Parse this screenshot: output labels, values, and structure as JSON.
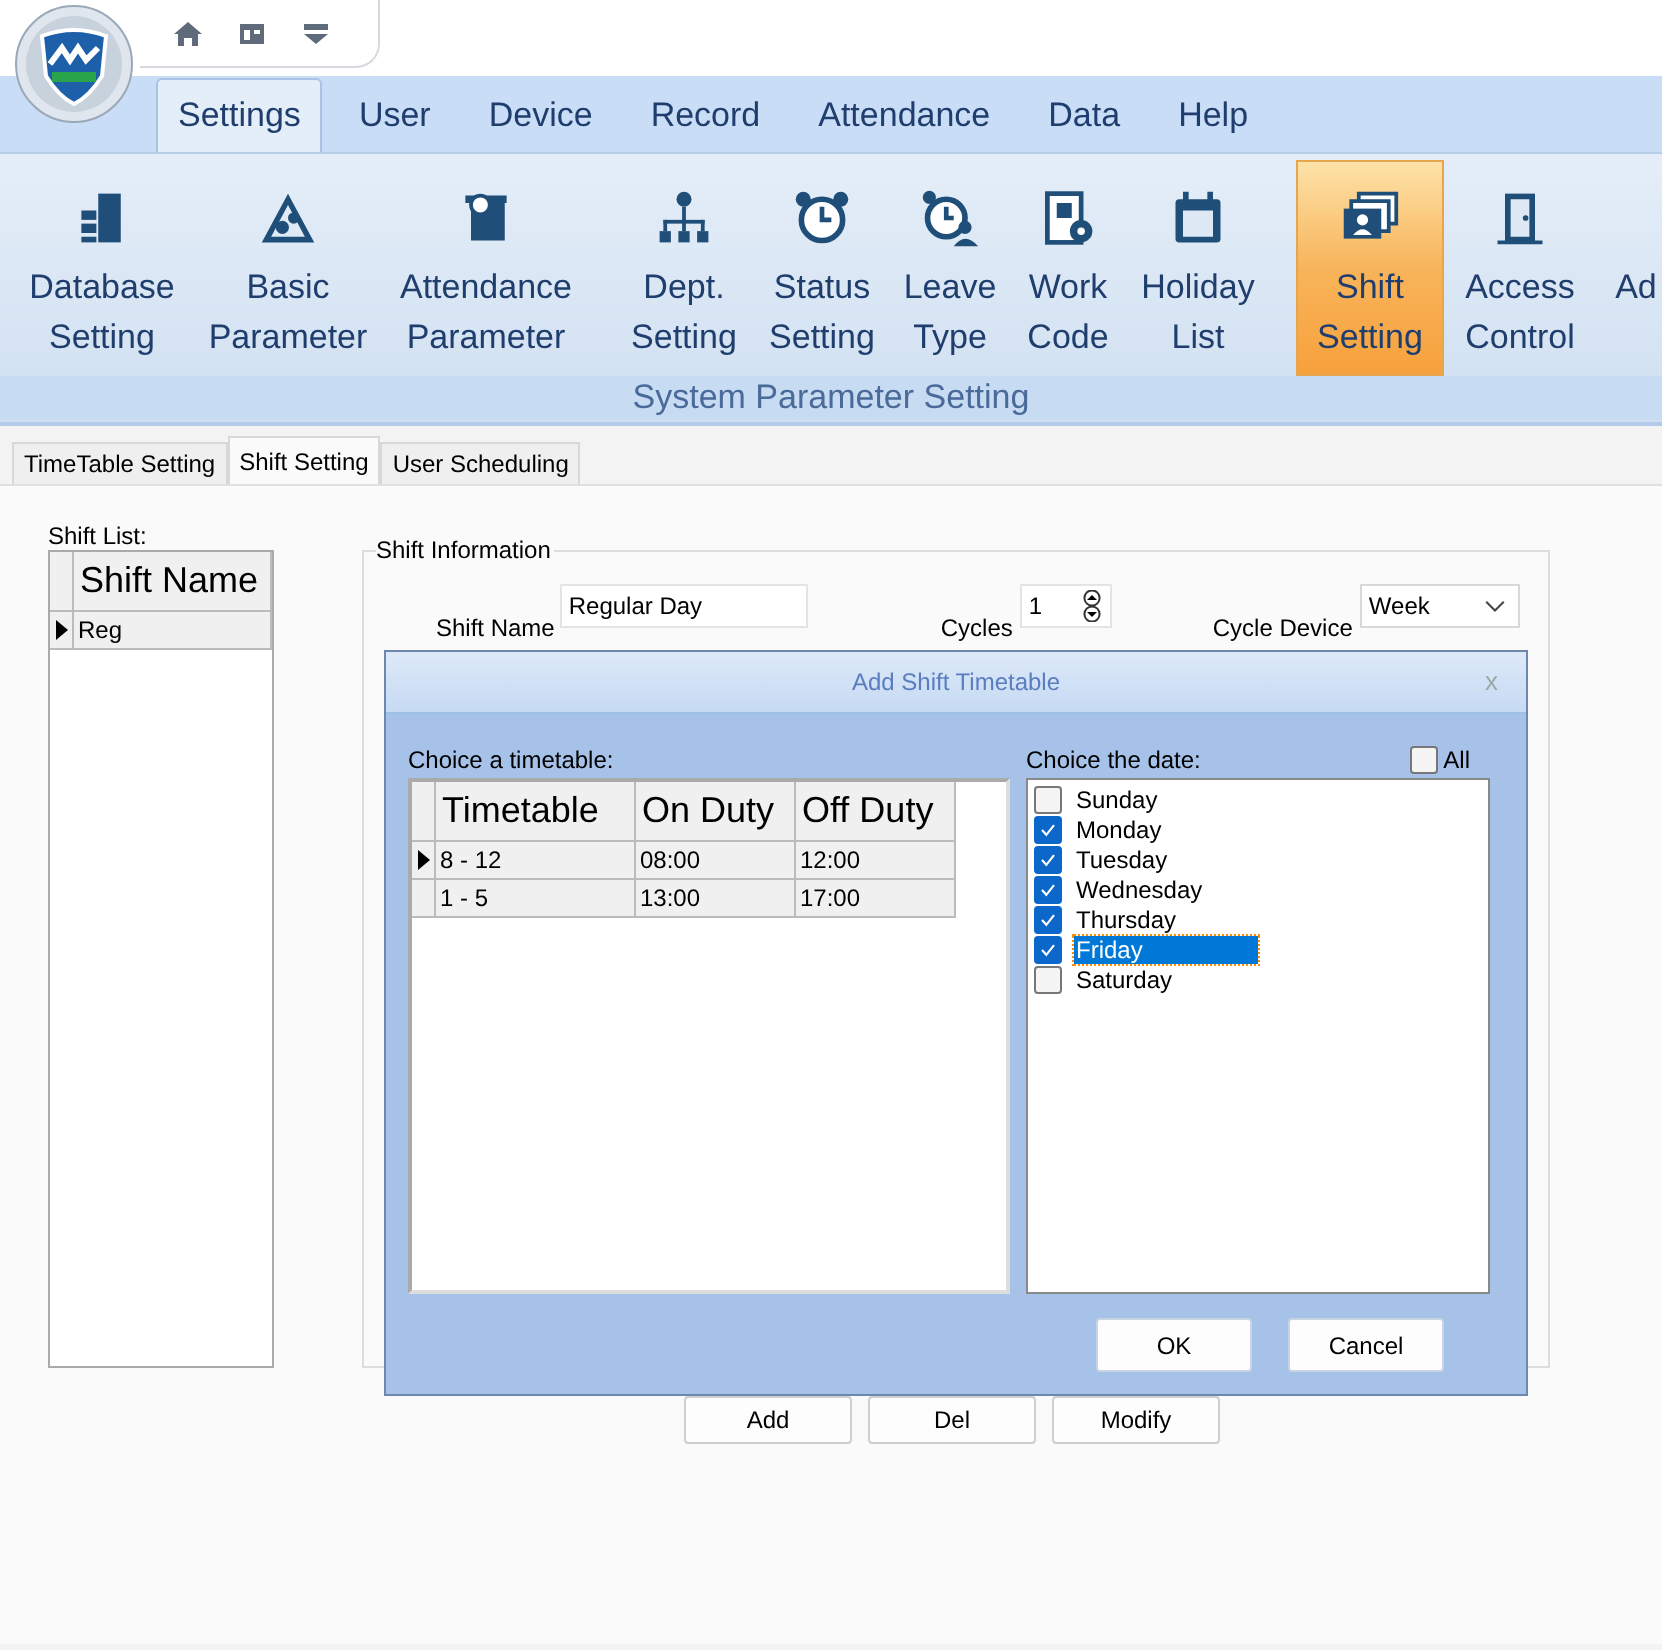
{
  "menu_tabs": [
    {
      "label": "Settings",
      "selected": true
    },
    {
      "label": "User",
      "selected": false
    },
    {
      "label": "Device",
      "selected": false
    },
    {
      "label": "Record",
      "selected": false
    },
    {
      "label": "Attendance",
      "selected": false
    },
    {
      "label": "Data",
      "selected": false
    },
    {
      "label": "Help",
      "selected": false
    }
  ],
  "ribbon_groups": [
    {
      "buttons": [
        {
          "lines": [
            "Database",
            "Setting"
          ],
          "selected": false
        },
        {
          "lines": [
            "Basic",
            "Parameter"
          ],
          "selected": false
        },
        {
          "lines": [
            "Attendance",
            "Parameter"
          ],
          "selected": false
        }
      ]
    },
    {
      "buttons": [
        {
          "lines": [
            "Dept.",
            "Setting"
          ],
          "selected": false
        },
        {
          "lines": [
            "Status",
            "Setting"
          ],
          "selected": false
        },
        {
          "lines": [
            "Leave",
            "Type"
          ],
          "selected": false
        },
        {
          "lines": [
            "Work",
            "Code"
          ],
          "selected": false
        },
        {
          "lines": [
            "Holiday",
            "List"
          ],
          "selected": false
        }
      ]
    },
    {
      "buttons": [
        {
          "lines": [
            "Shift",
            "Setting"
          ],
          "selected": true
        },
        {
          "lines": [
            "Access",
            "Control"
          ],
          "selected": false
        },
        {
          "lines": [
            "Ad"
          ],
          "selected": false
        }
      ]
    }
  ],
  "ribbon_group_label": "System Parameter Setting",
  "sub_tabs": [
    {
      "label": "TimeTable Setting",
      "selected": false
    },
    {
      "label": "Shift Setting",
      "selected": true
    },
    {
      "label": "User Scheduling",
      "selected": false
    }
  ],
  "shift_list": {
    "label": "Shift List:",
    "column": "Shift Name",
    "rows": [
      {
        "name": "Reg",
        "selected": true
      }
    ]
  },
  "shift_info": {
    "title": "Shift Information",
    "shift_name_label": "Shift Name",
    "shift_name": "Regular Day",
    "cycles_label": "Cycles",
    "cycles": "1",
    "cycle_device_label": "Cycle Device",
    "cycle_device": "Week"
  },
  "dialog": {
    "title": "Add Shift Timetable",
    "close": "x",
    "timetable_label": "Choice a timetable:",
    "columns": [
      "Timetable",
      "On Duty",
      "Off Duty"
    ],
    "rows": [
      {
        "cells": [
          "8 - 12",
          "08:00",
          "12:00"
        ],
        "selected": true
      },
      {
        "cells": [
          "1 - 5",
          "13:00",
          "17:00"
        ],
        "selected": false
      }
    ],
    "date_label": "Choice the date:",
    "all": {
      "label": "All",
      "checked": false
    },
    "days": [
      {
        "label": "Sunday",
        "checked": false,
        "selected": false
      },
      {
        "label": "Monday",
        "checked": true,
        "selected": false
      },
      {
        "label": "Tuesday",
        "checked": true,
        "selected": false
      },
      {
        "label": "Wednesday",
        "checked": true,
        "selected": false
      },
      {
        "label": "Thursday",
        "checked": true,
        "selected": false
      },
      {
        "label": "Friday",
        "checked": true,
        "selected": true
      },
      {
        "label": "Saturday",
        "checked": false,
        "selected": false
      }
    ],
    "buttons": [
      "OK",
      "Cancel"
    ]
  },
  "buttons": [
    "Add",
    "Del",
    "Modify"
  ]
}
